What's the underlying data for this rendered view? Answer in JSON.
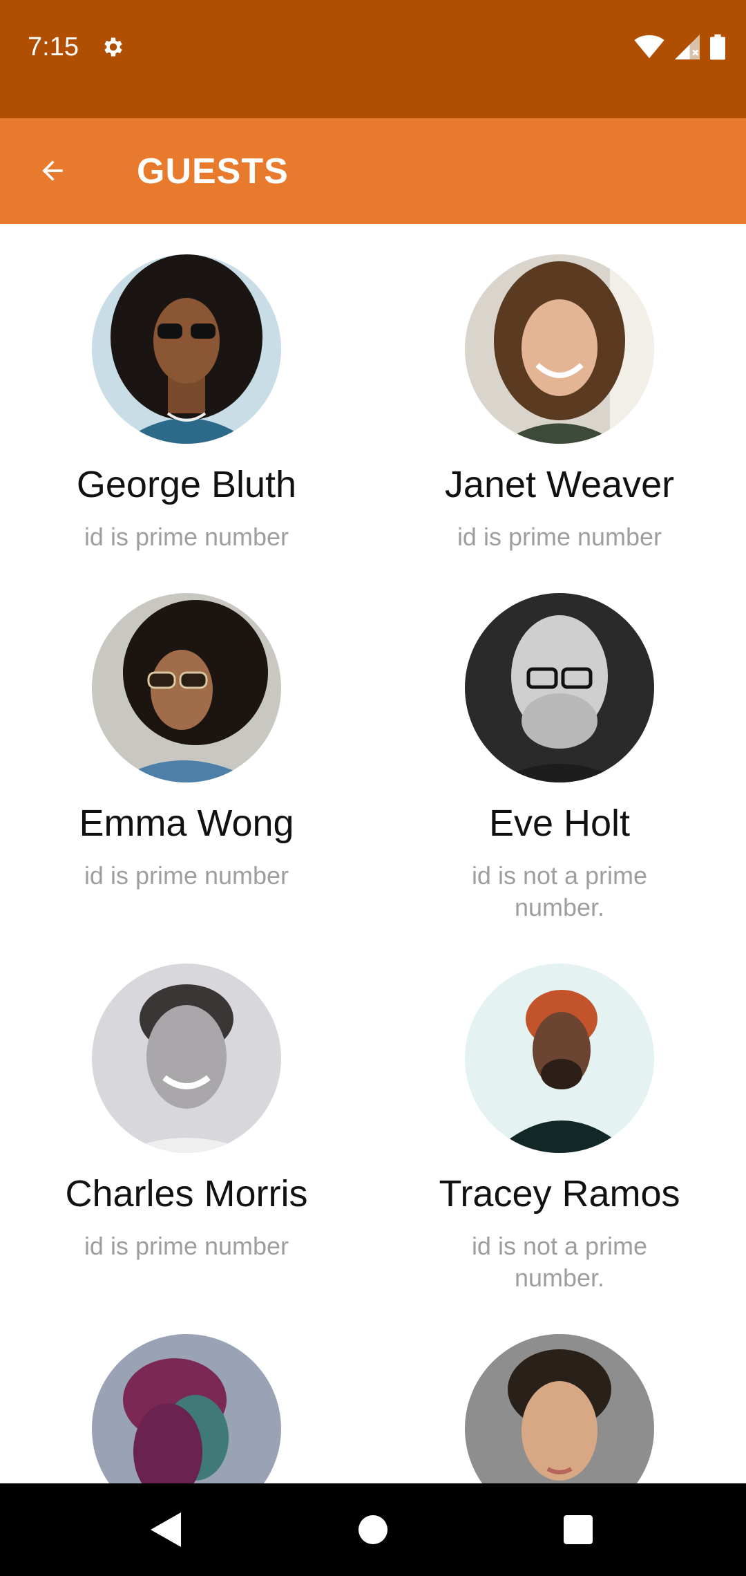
{
  "status_bar": {
    "time": "7:15",
    "icons": [
      "settings-icon",
      "wifi-icon",
      "signal-icon",
      "battery-icon"
    ]
  },
  "app_bar": {
    "title": "GUESTS",
    "back_icon": "arrow-back-icon",
    "background": "#E87A2E",
    "status_background": "#B04E02"
  },
  "guests": [
    {
      "name": "George Bluth",
      "description": "id is prime number"
    },
    {
      "name": "Janet Weaver",
      "description": "id is prime number"
    },
    {
      "name": "Emma Wong",
      "description": "id is prime number"
    },
    {
      "name": "Eve Holt",
      "description": "id is not a prime number."
    },
    {
      "name": "Charles Morris",
      "description": "id is prime number"
    },
    {
      "name": "Tracey Ramos",
      "description": "id is not a prime number."
    },
    {
      "name": "",
      "description": ""
    },
    {
      "name": "",
      "description": ""
    }
  ],
  "nav_bar": {
    "icons": [
      "back-triangle-icon",
      "home-circle-icon",
      "recents-square-icon"
    ]
  }
}
